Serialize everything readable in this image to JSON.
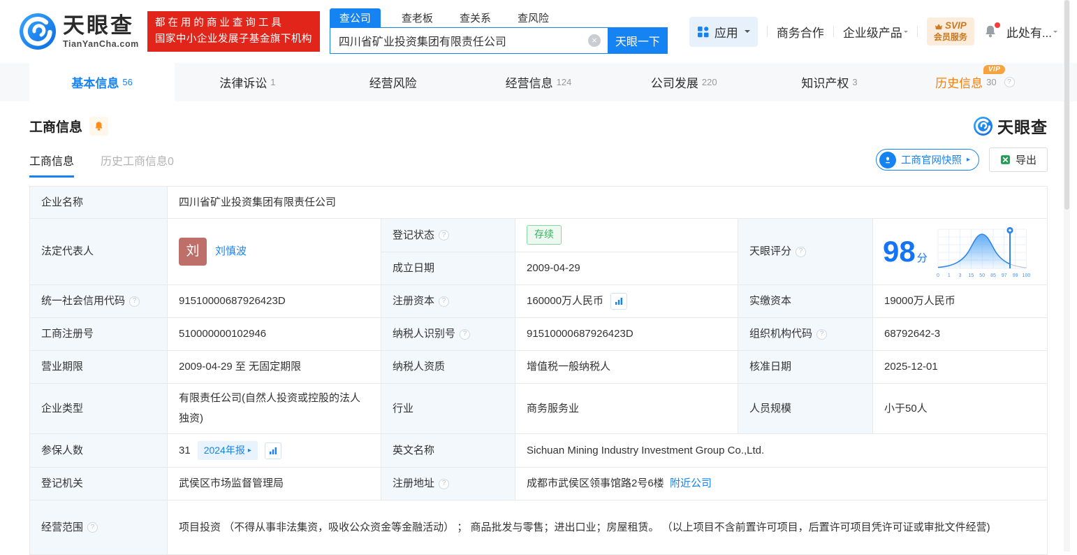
{
  "colors": {
    "brand_blue": "#1583f2",
    "badge_red": "#e1251b",
    "vip_orange": "#ff7d00",
    "status_green": "#36b35f",
    "label_bg": "#f2f8fc"
  },
  "header": {
    "brand": "天眼查",
    "brand_domain": "TianYanCha.com",
    "slogan_line1": "都在用的商业查询工具",
    "slogan_line2": "国家中小企业发展子基金旗下机构",
    "search": {
      "tabs": [
        {
          "label": "查公司",
          "active": true
        },
        {
          "label": "查老板",
          "active": false
        },
        {
          "label": "查关系",
          "active": false
        },
        {
          "label": "查风险",
          "active": false
        }
      ],
      "value": "四川省矿业投资集团有限责任公司",
      "button": "天眼一下"
    },
    "nav": {
      "apps": "应用",
      "cooperation": "商务合作",
      "enterprise": "企业级产品",
      "svip_top": "SVIP",
      "svip_bottom": "会员服务",
      "user": "此处有..."
    }
  },
  "tabs": [
    {
      "label": "基本信息",
      "count": "56",
      "active": true,
      "vip": false,
      "help": false
    },
    {
      "label": "法律诉讼",
      "count": "1",
      "active": false,
      "vip": false,
      "help": false
    },
    {
      "label": "经营风险",
      "count": "",
      "active": false,
      "vip": false,
      "help": false
    },
    {
      "label": "经营信息",
      "count": "124",
      "active": false,
      "vip": false,
      "help": false
    },
    {
      "label": "公司发展",
      "count": "220",
      "active": false,
      "vip": false,
      "help": false
    },
    {
      "label": "知识产权",
      "count": "3",
      "active": false,
      "vip": false,
      "help": false
    },
    {
      "label": "历史信息",
      "count": "30",
      "active": false,
      "vip": true,
      "help": true
    }
  ],
  "section": {
    "title": "工商信息",
    "watermark": "天眼查",
    "subtabs": [
      {
        "label": "工商信息",
        "active": true
      },
      {
        "label": "历史工商信息0",
        "active": false
      }
    ],
    "snapshot_button": "工商官网快照",
    "export_button": "导出"
  },
  "table": {
    "company_name_label": "企业名称",
    "company_name": "四川省矿业投资集团有限责任公司",
    "legal_rep_label": "法定代表人",
    "legal_rep_avatar": "刘",
    "legal_rep_name": "刘慎波",
    "reg_status_label": "登记状态",
    "reg_status": "存续",
    "establish_label": "成立日期",
    "establish_date": "2009-04-29",
    "score_label": "天眼评分",
    "credit_code_label": "统一社会信用代码",
    "credit_code": "91510000687926423D",
    "reg_capital_label": "注册资本",
    "reg_capital": "160000万人民币",
    "paid_capital_label": "实缴资本",
    "paid_capital": "19000万人民币",
    "reg_number_label": "工商注册号",
    "reg_number": "510000000102946",
    "taxpayer_id_label": "纳税人识别号",
    "taxpayer_id": "91510000687926423D",
    "org_code_label": "组织机构代码",
    "org_code": "68792642-3",
    "business_term_label": "营业期限",
    "business_term": "2009-04-29 至 无固定期限",
    "taxpayer_quality_label": "纳税人资质",
    "taxpayer_quality": "增值税一般纳税人",
    "approval_date_label": "核准日期",
    "approval_date": "2025-12-01",
    "company_type_label": "企业类型",
    "company_type": "有限责任公司(自然人投资或控股的法人独资)",
    "industry_label": "行业",
    "industry": "商务服务业",
    "staff_size_label": "人员规模",
    "staff_size": "小于50人",
    "insured_label": "参保人数",
    "insured_count": "31",
    "insured_report": "2024年报",
    "english_name_label": "英文名称",
    "english_name": "Sichuan Mining Industry Investment Group Co.,Ltd.",
    "reg_authority_label": "登记机关",
    "reg_authority": "武侯区市场监督管理局",
    "address_label": "注册地址",
    "address": "成都市武侯区领事馆路2号6楼",
    "nearby_link": "附近公司",
    "business_scope_label": "经营范围",
    "business_scope": "项目投资 （不得从事非法集资，吸收公众资金等金融活动） ； 商品批发与零售；进出口业；房屋租赁。 （以上项目不含前置许可项目，后置许可项目凭许可证或审批文件经营)"
  },
  "score": {
    "value": "98",
    "unit": "分",
    "axis_ticks": [
      "0",
      "1",
      "3",
      "15",
      "50",
      "85",
      "97",
      "99",
      "100"
    ],
    "marker_value": 98
  }
}
